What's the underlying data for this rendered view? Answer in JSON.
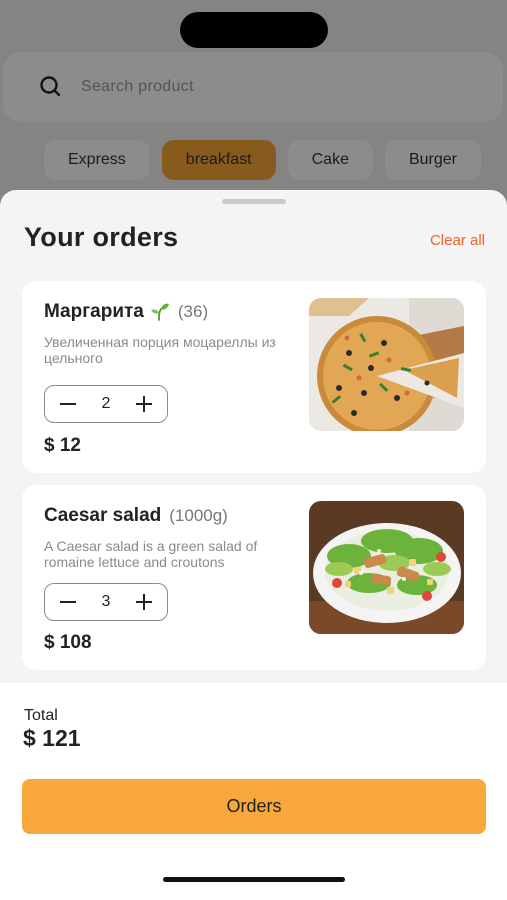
{
  "search": {
    "placeholder": "Search product"
  },
  "categories": [
    {
      "label": "Express",
      "active": false
    },
    {
      "label": "breakfast",
      "active": true
    },
    {
      "label": "Cake",
      "active": false
    },
    {
      "label": "Burger",
      "active": false
    }
  ],
  "sheet": {
    "title": "Your orders",
    "clear_all": "Clear all"
  },
  "orders": [
    {
      "name": "Маргарита",
      "meta": "(36)",
      "has_veg_icon": true,
      "description": "Увеличенная порция моцареллы из цельного",
      "quantity": "2",
      "price": "$ 12",
      "image": "pizza-image"
    },
    {
      "name": "Caesar salad",
      "meta": "(1000g)",
      "has_veg_icon": false,
      "description": "A Caesar salad is a green salad of romaine lettuce and croutons",
      "quantity": "3",
      "price": "$ 108",
      "image": "salad-image"
    }
  ],
  "footer": {
    "total_label": "Total",
    "total_value": "$ 121",
    "order_button": "Orders"
  },
  "colors": {
    "accent": "#f8a83a",
    "clear_all": "#f0622a",
    "sheet_bg": "#f4f4f4",
    "card_bg": "#ffffff"
  }
}
